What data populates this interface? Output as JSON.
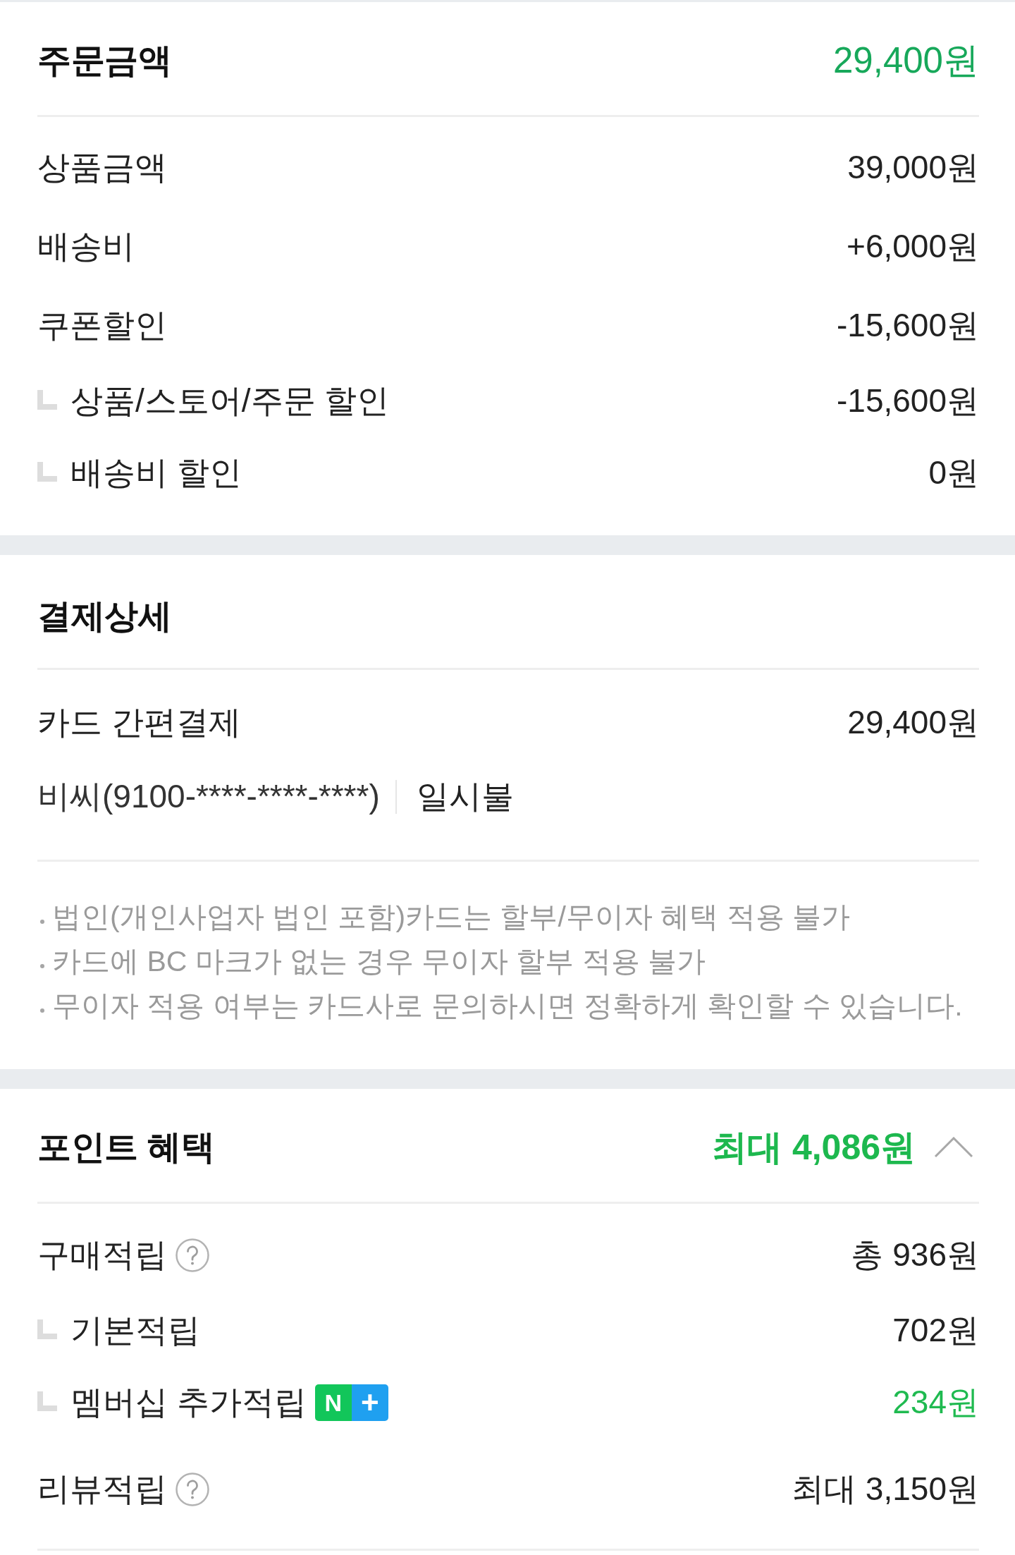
{
  "order_amount": {
    "title": "주문금액",
    "total": "29,400원",
    "rows": [
      {
        "kind": "main",
        "label": "상품금액",
        "value": "39,000원"
      },
      {
        "kind": "main",
        "label": "배송비",
        "value": "+6,000원"
      },
      {
        "kind": "main",
        "label": "쿠폰할인",
        "value": "-15,600원"
      },
      {
        "kind": "sub",
        "label": "상품/스토어/주문 할인",
        "value": "-15,600원"
      },
      {
        "kind": "sub",
        "label": "배송비 할인",
        "value": "0원"
      }
    ]
  },
  "payment_details": {
    "title": "결제상세",
    "method": {
      "label": "카드 간편결제",
      "value": "29,400원"
    },
    "card": {
      "name": "비씨(9100-****-****-****)",
      "installment": "일시불"
    },
    "notes": [
      "법인(개인사업자 법인 포함)카드는 할부/무이자 혜택 적용 불가",
      "카드에 BC 마크가 없는 경우 무이자 할부 적용 불가",
      "무이자 적용 여부는 카드사로 문의하시면 정확하게 확인할 수 있습니다."
    ]
  },
  "point_benefits": {
    "title": "포인트 혜택",
    "total": "최대 4,086원",
    "expanded": true,
    "rows": [
      {
        "kind": "main",
        "label": "구매적립",
        "help": true,
        "value": "총 936원",
        "highlight": false
      },
      {
        "kind": "sub",
        "label": "기본적립",
        "help": false,
        "value": "702원",
        "highlight": false
      },
      {
        "kind": "sub",
        "label": "멤버십 추가적립",
        "help": false,
        "badge": {
          "left": "N",
          "right": "+"
        },
        "value": "234원",
        "highlight": true
      },
      {
        "kind": "main",
        "label": "리뷰적립",
        "help": true,
        "value": "최대 3,150원",
        "highlight": false
      }
    ]
  }
}
